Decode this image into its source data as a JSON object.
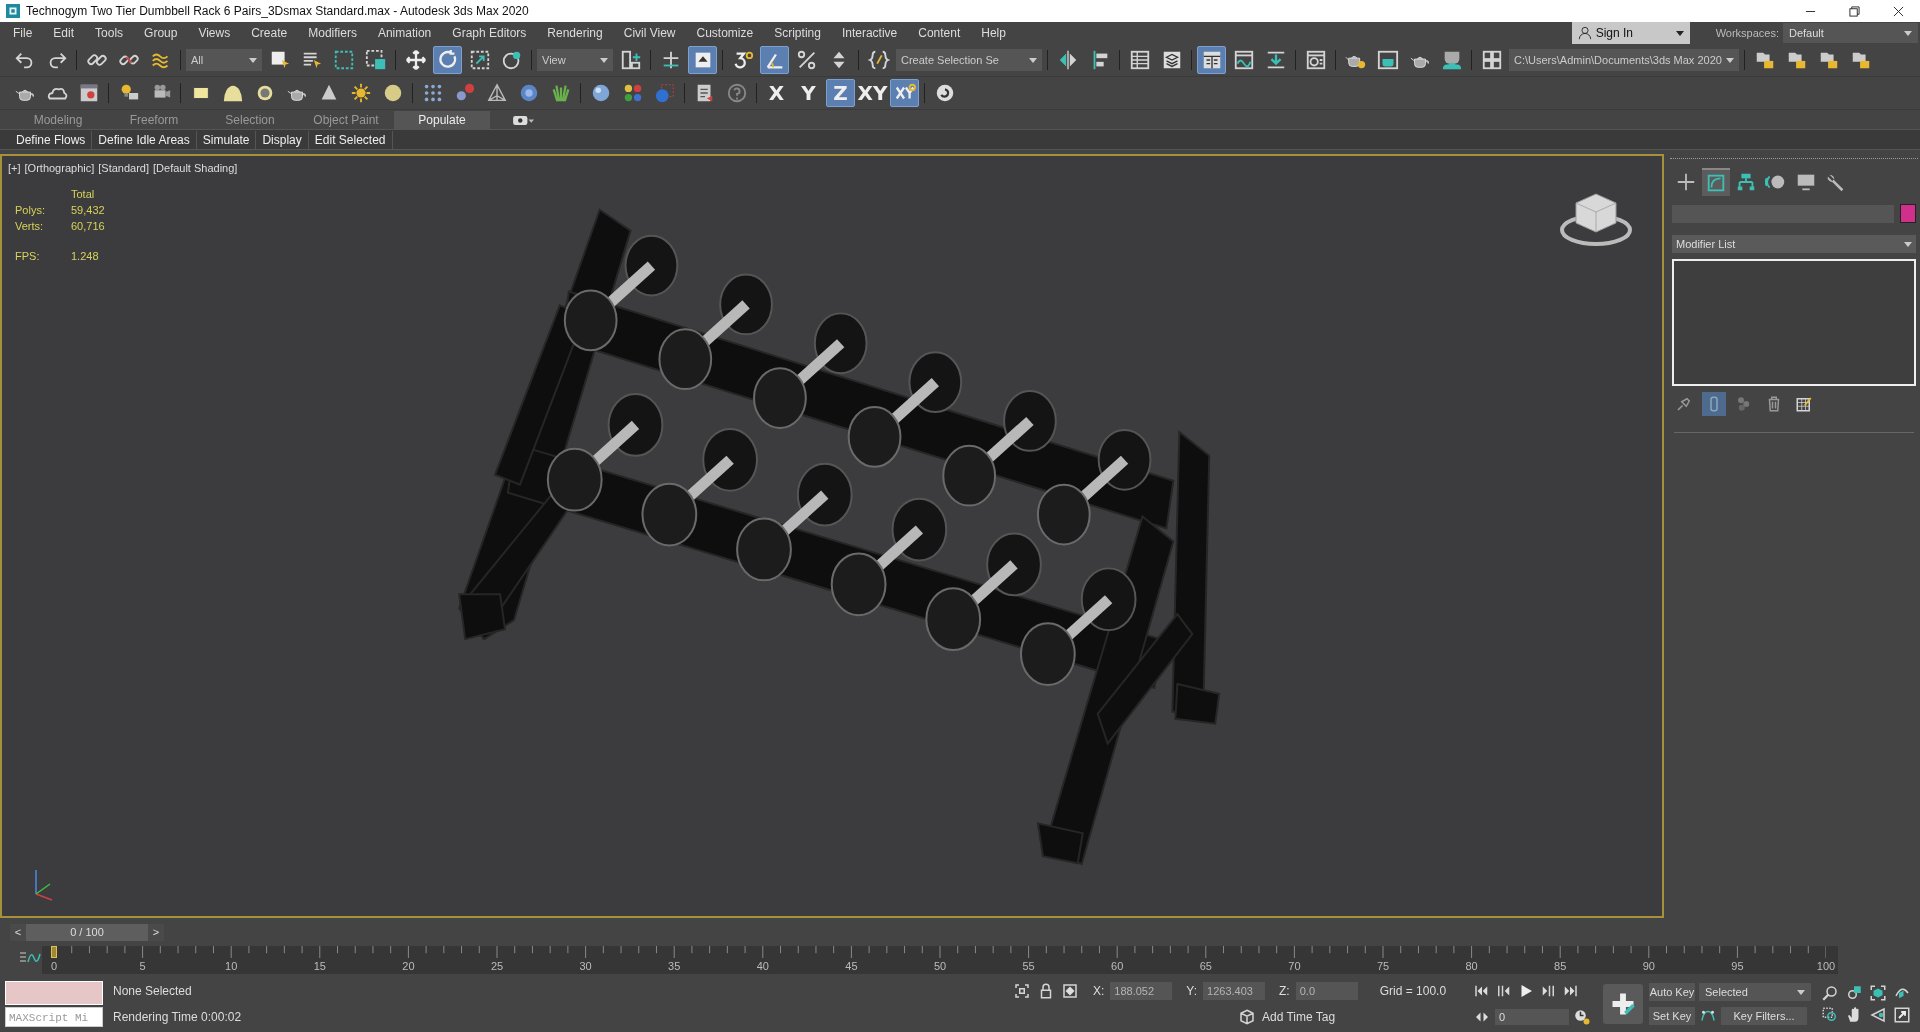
{
  "window": {
    "title": "Technogym Two Tier Dumbbell Rack 6 Pairs_3Dsmax Standard.max - Autodesk 3ds Max 2020"
  },
  "menu": [
    "File",
    "Edit",
    "Tools",
    "Group",
    "Views",
    "Create",
    "Modifiers",
    "Animation",
    "Graph Editors",
    "Rendering",
    "Civil View",
    "Customize",
    "Scripting",
    "Interactive",
    "Content",
    "Help"
  ],
  "account": {
    "label": "Sign In"
  },
  "workspaces": {
    "label": "Workspaces:",
    "value": "Default"
  },
  "main_toolbar": {
    "groups": [
      [
        {
          "kind": "button",
          "selected": false
        },
        {
          "kind": "button",
          "selected": false
        }
      ],
      [
        {
          "kind": "button",
          "selected": false
        },
        {
          "kind": "button",
          "selected": false
        },
        {
          "kind": "button",
          "selected": false
        }
      ],
      [
        {
          "kind": "dropdown",
          "value": "All"
        },
        {
          "kind": "button",
          "selected": false
        },
        {
          "kind": "button",
          "selected": false
        },
        {
          "kind": "button",
          "selected": false
        },
        {
          "kind": "button",
          "selected": false
        }
      ],
      [
        {
          "kind": "button",
          "selected": false
        },
        {
          "kind": "button",
          "selected": true
        },
        {
          "kind": "button",
          "selected": false
        },
        {
          "kind": "button",
          "selected": false
        }
      ],
      [
        {
          "kind": "dropdown",
          "value": "View"
        },
        {
          "kind": "button",
          "selected": false
        }
      ],
      [
        {
          "kind": "button",
          "selected": false
        },
        {
          "kind": "button",
          "selected": true
        }
      ],
      [
        {
          "kind": "button",
          "selected": false
        },
        {
          "kind": "button",
          "selected": true
        },
        {
          "kind": "button",
          "selected": false
        },
        {
          "kind": "button",
          "selected": false
        }
      ],
      [
        {
          "kind": "button",
          "selected": false
        },
        {
          "kind": "dropdown",
          "value": "Create Selection Se"
        }
      ],
      [
        {
          "kind": "button",
          "selected": false
        },
        {
          "kind": "button",
          "selected": false
        }
      ],
      [
        {
          "kind": "button",
          "selected": false
        },
        {
          "kind": "button",
          "selected": false
        }
      ],
      [
        {
          "kind": "button",
          "selected": true
        },
        {
          "kind": "button",
          "selected": false
        },
        {
          "kind": "button",
          "selected": false
        }
      ],
      [
        {
          "kind": "button",
          "selected": false
        }
      ],
      [
        {
          "kind": "button",
          "selected": false
        },
        {
          "kind": "button",
          "selected": false
        },
        {
          "kind": "button",
          "selected": false
        },
        {
          "kind": "button",
          "selected": false
        }
      ],
      [
        {
          "kind": "button",
          "selected": false
        },
        {
          "kind": "dropdown",
          "value": "C:\\Users\\Admin\\Documents\\3ds Max 2020"
        }
      ],
      [
        {
          "kind": "button",
          "selected": false
        },
        {
          "kind": "button",
          "selected": false
        },
        {
          "kind": "button",
          "selected": false
        },
        {
          "kind": "button",
          "selected": false
        }
      ]
    ]
  },
  "objects_toolbar": {
    "groups": [
      [
        {
          "kind": "button",
          "selected": false
        },
        {
          "kind": "button",
          "selected": false
        },
        {
          "kind": "button",
          "selected": false
        }
      ],
      [
        {
          "kind": "button",
          "selected": false
        },
        {
          "kind": "button",
          "selected": false
        }
      ],
      [
        {
          "kind": "button",
          "selected": false
        },
        {
          "kind": "button",
          "selected": false
        },
        {
          "kind": "button",
          "selected": false
        },
        {
          "kind": "button",
          "selected": false
        },
        {
          "kind": "button",
          "selected": false
        },
        {
          "kind": "button",
          "selected": false
        },
        {
          "kind": "button",
          "selected": false
        }
      ],
      [
        {
          "kind": "button",
          "selected": false
        },
        {
          "kind": "button",
          "selected": false
        },
        {
          "kind": "button",
          "selected": false
        },
        {
          "kind": "button",
          "selected": false
        },
        {
          "kind": "button",
          "selected": false
        }
      ],
      [
        {
          "kind": "button",
          "selected": false
        },
        {
          "kind": "button",
          "selected": false
        },
        {
          "kind": "button",
          "selected": false
        }
      ],
      [
        {
          "kind": "button",
          "selected": false
        },
        {
          "kind": "button",
          "selected": false
        }
      ],
      [
        {
          "kind": "axis",
          "label": "X",
          "selected": false
        },
        {
          "kind": "axis",
          "label": "Y",
          "selected": false
        },
        {
          "kind": "axis",
          "label": "Z",
          "selected": true
        },
        {
          "kind": "axis",
          "label": "XY",
          "selected": false
        },
        {
          "kind": "button",
          "selected": true
        }
      ],
      [
        {
          "kind": "button",
          "selected": false
        }
      ]
    ]
  },
  "ribbon": {
    "tabs": [
      {
        "label": "Modeling",
        "selected": false
      },
      {
        "label": "Freeform",
        "selected": false
      },
      {
        "label": "Selection",
        "selected": false
      },
      {
        "label": "Object Paint",
        "selected": false
      },
      {
        "label": "Populate",
        "selected": true
      }
    ],
    "buttons": [
      "Define Flows",
      "Define Idle Areas",
      "Simulate",
      "Display",
      "Edit Selected"
    ]
  },
  "viewport": {
    "labels": [
      "[+]",
      "[Orthographic]",
      "[Standard]",
      "[Default Shading]"
    ],
    "stats_header": "Total",
    "stats": [
      {
        "label": "Polys:",
        "value": "59,432"
      },
      {
        "label": "Verts:",
        "value": "60,716"
      }
    ],
    "fps": {
      "label": "FPS:",
      "value": "1.248"
    }
  },
  "command_panel": {
    "tabs": [
      {
        "selected": false
      },
      {
        "selected": true
      },
      {
        "selected": false
      },
      {
        "selected": false
      },
      {
        "selected": false
      },
      {
        "selected": false
      }
    ],
    "modifier_list": "Modifier List",
    "stack_tools": [
      {
        "selected": false
      },
      {
        "selected": true
      },
      {
        "selected": false
      },
      {
        "selected": false
      },
      {
        "selected": false
      }
    ]
  },
  "time_slider": {
    "prev": "<",
    "label": "0 / 100",
    "next": ">",
    "level": 0
  },
  "ruler": {
    "labels": [
      "0",
      "5",
      "10",
      "15",
      "20",
      "25",
      "30",
      "35",
      "40",
      "45",
      "50",
      "55",
      "60",
      "65",
      "70",
      "75",
      "80",
      "85",
      "90",
      "95",
      "100"
    ]
  },
  "status": {
    "maxscript": "MAXScript Mi",
    "selection": "None Selected",
    "prompt": "Rendering Time  0:00:02",
    "coords": [
      {
        "label": "X:",
        "value": "188.052"
      },
      {
        "label": "Y:",
        "value": "1263.403"
      },
      {
        "label": "Z:",
        "value": "0.0"
      }
    ],
    "grid": "Grid = 100.0",
    "add_time_tag": "Add Time Tag",
    "frame": "0",
    "auto_key": "Auto Key",
    "set_key": "Set Key",
    "key_mode": "Selected",
    "key_filters": "Key Filters..."
  }
}
